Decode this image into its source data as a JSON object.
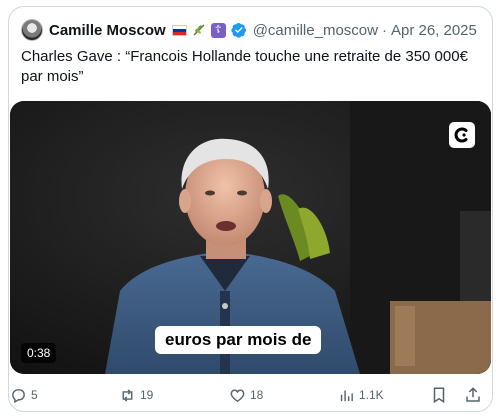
{
  "author": {
    "display_name": "Camille Moscow",
    "handle": "@camille_moscow",
    "separator": "·",
    "date": "Apr 26, 2025",
    "avatar_icon": "profile-photo",
    "badges": [
      "russia-flag-icon",
      "sprig-icon",
      "orthodox-cross-icon",
      "verified-icon"
    ],
    "verified_color": "#1d9bf0"
  },
  "tweet": {
    "text": "Charles Gave : “Francois Hollande touche une retraite de 350 000€ par mois”"
  },
  "media": {
    "type": "video",
    "caption": "euros par mois de",
    "duration": "0:38",
    "app_logo_icon": "c-logo-icon"
  },
  "actions": {
    "replies": "5",
    "reposts": "19",
    "likes": "18",
    "views": "1.1K"
  },
  "colors": {
    "text_primary": "#0f1419",
    "text_secondary": "#536471",
    "border": "#cfd9de",
    "accent": "#1d9bf0"
  }
}
